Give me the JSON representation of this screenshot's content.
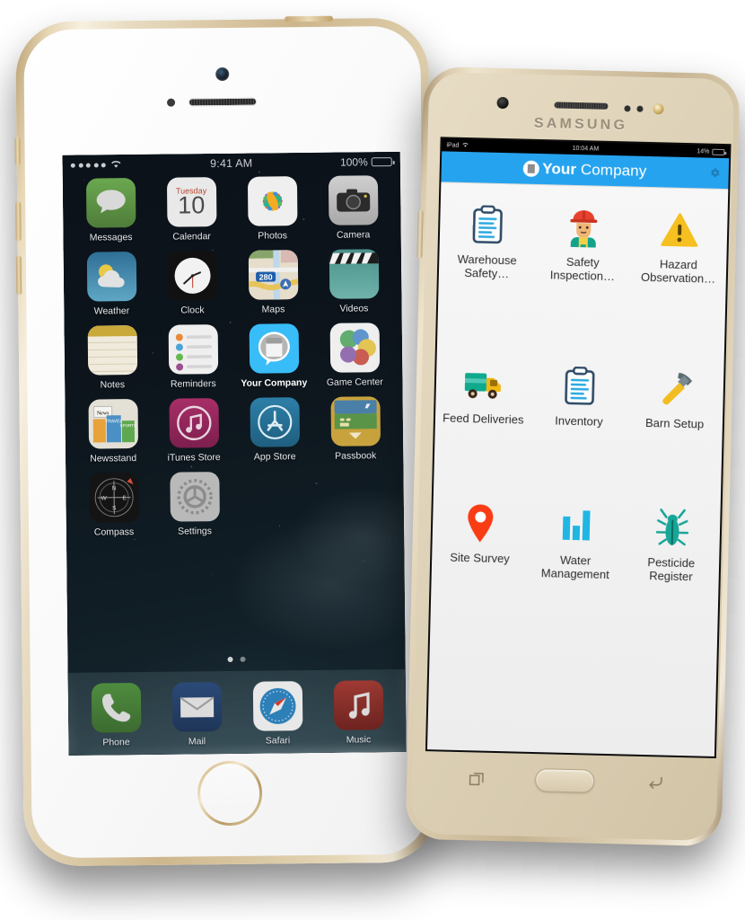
{
  "scene": {
    "description": "Two smartphones side by side showing a mobile app",
    "devices": [
      "iphone",
      "samsung"
    ]
  },
  "iphone": {
    "brand_color": "#cdb68c",
    "status_bar": {
      "carrier_dots": 5,
      "wifi_icon": "wifi-icon",
      "time": "9:41 AM",
      "battery_percent": "100%",
      "battery_level": 100
    },
    "apps": [
      {
        "label": "Messages",
        "icon": "messages-icon"
      },
      {
        "label": "Calendar",
        "icon": "calendar-icon",
        "weekday": "Tuesday",
        "day": "10"
      },
      {
        "label": "Photos",
        "icon": "photos-icon"
      },
      {
        "label": "Camera",
        "icon": "camera-icon"
      },
      {
        "label": "Weather",
        "icon": "weather-icon"
      },
      {
        "label": "Clock",
        "icon": "clock-icon"
      },
      {
        "label": "Maps",
        "icon": "maps-icon",
        "route_shield": "280"
      },
      {
        "label": "Videos",
        "icon": "videos-icon"
      },
      {
        "label": "Notes",
        "icon": "notes-icon"
      },
      {
        "label": "Reminders",
        "icon": "reminders-icon"
      },
      {
        "label": "Your Company",
        "icon": "your-company-icon",
        "highlighted": true
      },
      {
        "label": "Game Center",
        "icon": "game-center-icon"
      },
      {
        "label": "Newsstand",
        "icon": "newsstand-icon"
      },
      {
        "label": "iTunes Store",
        "icon": "itunes-store-icon"
      },
      {
        "label": "App Store",
        "icon": "app-store-icon"
      },
      {
        "label": "Passbook",
        "icon": "passbook-icon"
      },
      {
        "label": "Compass",
        "icon": "compass-icon"
      },
      {
        "label": "Settings",
        "icon": "settings-icon"
      }
    ],
    "page_dots": {
      "total": 2,
      "active": 1
    },
    "dock": [
      {
        "label": "Phone",
        "icon": "phone-icon"
      },
      {
        "label": "Mail",
        "icon": "mail-icon"
      },
      {
        "label": "Safari",
        "icon": "safari-icon"
      },
      {
        "label": "Music",
        "icon": "music-icon"
      }
    ],
    "home_button": "home-button"
  },
  "samsung": {
    "brand": "SAMSUNG",
    "brand_color": "#c7b492",
    "status_bar": {
      "carrier": "iPad",
      "wifi_icon": "wifi-icon",
      "time": "10:04 AM",
      "battery_percent": "14%",
      "battery_level": 14
    },
    "header": {
      "accent_color": "#26a3ef",
      "logo": "your-company-logo-icon",
      "title_bold": "Your",
      "title_regular": " Company",
      "settings_icon": "gear-icon"
    },
    "tiles": [
      {
        "label": "Warehouse Safety…",
        "icon": "clipboard-icon"
      },
      {
        "label": "Safety Inspection…",
        "icon": "worker-icon"
      },
      {
        "label": "Hazard Observation…",
        "icon": "warning-triangle-icon"
      },
      {
        "label": "Feed Deliveries",
        "icon": "truck-icon"
      },
      {
        "label": "Inventory",
        "icon": "clipboard-icon"
      },
      {
        "label": "Barn Setup",
        "icon": "hammer-icon"
      },
      {
        "label": "Site Survey",
        "icon": "map-pin-icon"
      },
      {
        "label": "Water Management",
        "icon": "bar-chart-icon"
      },
      {
        "label": "Pesticide Register",
        "icon": "bug-icon"
      }
    ],
    "nav": {
      "recent_apps": "recent-apps-icon",
      "home": "home-button",
      "back": "back-icon"
    }
  }
}
